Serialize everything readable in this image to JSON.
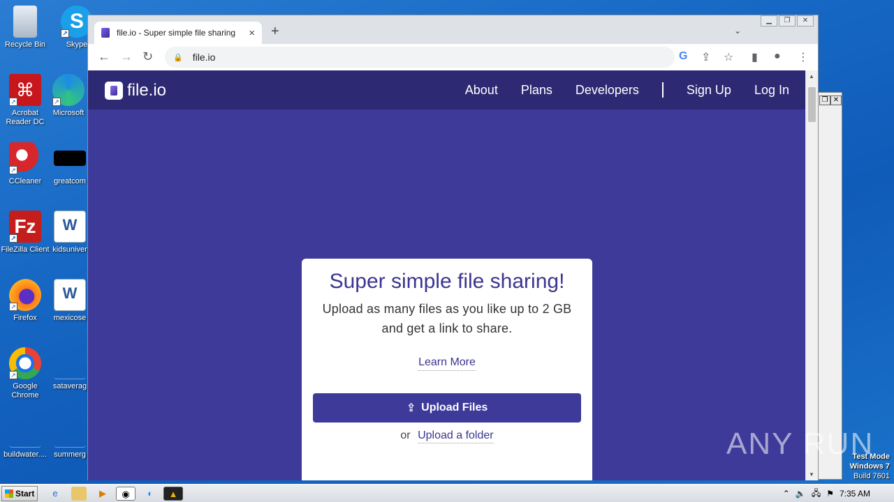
{
  "desktop": {
    "icons": [
      {
        "label": "Recycle Bin"
      },
      {
        "label": "Skype"
      },
      {
        "label": "Acrobat Reader DC"
      },
      {
        "label": "Microsoft"
      },
      {
        "label": "CCleaner"
      },
      {
        "label": "greatcom"
      },
      {
        "label": "FileZilla Client"
      },
      {
        "label": "kidsuniver"
      },
      {
        "label": "Firefox"
      },
      {
        "label": "mexicose"
      },
      {
        "label": "Google Chrome"
      },
      {
        "label": "sataverag"
      },
      {
        "label": "buildwater...."
      },
      {
        "label": "summerg"
      }
    ],
    "watermark": "ANY RUN",
    "test_mode": {
      "line1": "Test Mode",
      "line2": "Windows 7",
      "line3": "Build 7601"
    }
  },
  "browser": {
    "tab": {
      "title": "file.io - Super simple file sharing",
      "close": "×"
    },
    "new_tab": "+",
    "tab_menu": "⌄",
    "window_controls": {
      "minimize": "▁",
      "restore": "❐",
      "close": "✕"
    },
    "nav": {
      "back": "←",
      "forward": "→",
      "reload": "↻"
    },
    "address": {
      "lock": "🔒",
      "url": "file.io"
    },
    "toolbar_icons": {
      "google": "G",
      "share": "⇪",
      "bookmark": "☆",
      "sidepanel": "▮",
      "profile": "●",
      "menu": "⋮"
    }
  },
  "page": {
    "logo": "file.io",
    "nav": {
      "about": "About",
      "plans": "Plans",
      "developers": "Developers",
      "signup": "Sign Up",
      "login": "Log In"
    },
    "card": {
      "headline": "Super simple file sharing!",
      "subline": "Upload as many files as you like up to 2 GB and get a link to share.",
      "learn_more": "Learn More",
      "upload_button": "Upload Files",
      "upload_icon": "⇪",
      "or_text": "or",
      "upload_folder": "Upload a folder"
    }
  },
  "taskbar": {
    "start": "Start",
    "clock": "7:35 AM"
  }
}
